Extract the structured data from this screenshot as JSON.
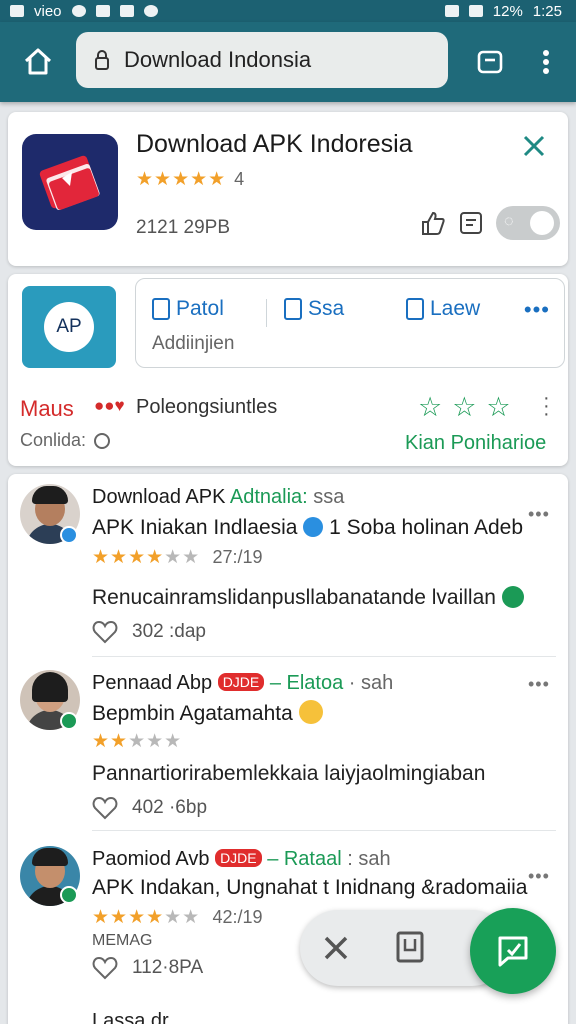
{
  "status_bar": {
    "left_text": "vieo",
    "battery": "12%",
    "time": "1:25"
  },
  "toolbar": {
    "url": "Download Indonsia"
  },
  "app_card": {
    "title": "Download APK Indoresia",
    "rating_text": "4",
    "size": "2121 29PB"
  },
  "tabs_card": {
    "icon_text": "AP",
    "tabs": [
      {
        "label": "Patol"
      },
      {
        "label": "Ssa"
      },
      {
        "label": "Laew"
      }
    ],
    "subtitle": "Addiinjien",
    "brand": "Maus",
    "description": "Poleongsiuntles",
    "condition": "Conlida:",
    "link": "Kian Poniharioe"
  },
  "reviews": [
    {
      "name": "Download APK",
      "tag": "Adtnalia:",
      "meta": "ssa",
      "title": "APK Iniakan Indlaesia",
      "title_tail": "1 Soba holinan Adeb",
      "stars_on": "★★★★",
      "stars_off": "★★",
      "date": "27:/19",
      "body": "Renucainramslidanpusllabanatande lvaillan",
      "likes": "302 :dap",
      "avatar_badge": "#2a8fe0"
    },
    {
      "name": "Pennaad Abp",
      "pill": "DJDE",
      "tag": "– Elatoa",
      "meta": "· sah",
      "title": "Bepmbin Agatamahta",
      "stars_on": "★★",
      "stars_off": "★★★",
      "date": "",
      "body": "Pannartiorirabemlekkaia laiyjaolmingiaban",
      "likes": "402 ·6bp",
      "avatar_badge": "#1b9a56"
    },
    {
      "name": "Paomiod Avb",
      "pill": "DJDE",
      "tag": "– Rataal",
      "meta": ": sah",
      "title": "APK Indakan, Ungnahat t Inidnang &radomaiia",
      "stars_on": "★★★★",
      "stars_off": "★★",
      "date": "42:/19",
      "extra": "MEMAG",
      "body": "",
      "likes": "112·8PA",
      "avatar_badge": "#1b9a56"
    }
  ],
  "bottom_peek": "Lassa dr",
  "colors": {
    "toolbar": "#1f6a7a",
    "accent_green": "#1b9a56",
    "accent_blue": "#1a6fc0",
    "star": "#f2a02a"
  },
  "icons": [
    "home-icon",
    "lock-icon",
    "tab-switcher-icon",
    "more-vertical-icon",
    "close-icon",
    "like-icon",
    "share-icon",
    "heart-icon",
    "chat-fab-icon"
  ]
}
